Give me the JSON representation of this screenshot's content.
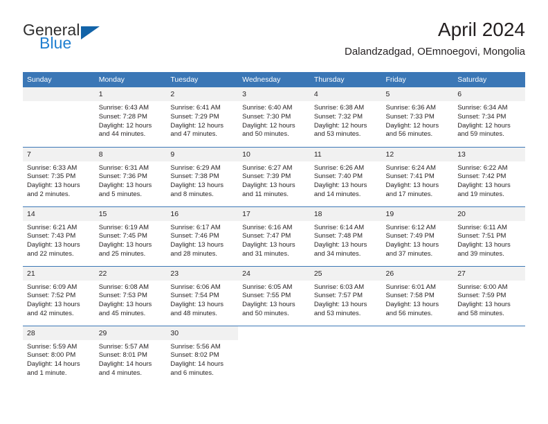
{
  "brand": {
    "name_part1": "General",
    "name_part2": "Blue",
    "accent_color": "#1263a8",
    "blue_text_color": "#1f7fd0"
  },
  "header": {
    "title": "April 2024",
    "subtitle": "Dalandzadgad, OEmnoegovi, Mongolia"
  },
  "calendar": {
    "header_color": "#3b77b6",
    "daynum_band_color": "#f1f1f1",
    "weekday_headers": [
      "Sunday",
      "Monday",
      "Tuesday",
      "Wednesday",
      "Thursday",
      "Friday",
      "Saturday"
    ],
    "weeks": [
      [
        {
          "day": "",
          "sunrise": "",
          "sunset": "",
          "daylight_line1": "",
          "daylight_line2": ""
        },
        {
          "day": "1",
          "sunrise": "Sunrise: 6:43 AM",
          "sunset": "Sunset: 7:28 PM",
          "daylight_line1": "Daylight: 12 hours",
          "daylight_line2": "and 44 minutes."
        },
        {
          "day": "2",
          "sunrise": "Sunrise: 6:41 AM",
          "sunset": "Sunset: 7:29 PM",
          "daylight_line1": "Daylight: 12 hours",
          "daylight_line2": "and 47 minutes."
        },
        {
          "day": "3",
          "sunrise": "Sunrise: 6:40 AM",
          "sunset": "Sunset: 7:30 PM",
          "daylight_line1": "Daylight: 12 hours",
          "daylight_line2": "and 50 minutes."
        },
        {
          "day": "4",
          "sunrise": "Sunrise: 6:38 AM",
          "sunset": "Sunset: 7:32 PM",
          "daylight_line1": "Daylight: 12 hours",
          "daylight_line2": "and 53 minutes."
        },
        {
          "day": "5",
          "sunrise": "Sunrise: 6:36 AM",
          "sunset": "Sunset: 7:33 PM",
          "daylight_line1": "Daylight: 12 hours",
          "daylight_line2": "and 56 minutes."
        },
        {
          "day": "6",
          "sunrise": "Sunrise: 6:34 AM",
          "sunset": "Sunset: 7:34 PM",
          "daylight_line1": "Daylight: 12 hours",
          "daylight_line2": "and 59 minutes."
        }
      ],
      [
        {
          "day": "7",
          "sunrise": "Sunrise: 6:33 AM",
          "sunset": "Sunset: 7:35 PM",
          "daylight_line1": "Daylight: 13 hours",
          "daylight_line2": "and 2 minutes."
        },
        {
          "day": "8",
          "sunrise": "Sunrise: 6:31 AM",
          "sunset": "Sunset: 7:36 PM",
          "daylight_line1": "Daylight: 13 hours",
          "daylight_line2": "and 5 minutes."
        },
        {
          "day": "9",
          "sunrise": "Sunrise: 6:29 AM",
          "sunset": "Sunset: 7:38 PM",
          "daylight_line1": "Daylight: 13 hours",
          "daylight_line2": "and 8 minutes."
        },
        {
          "day": "10",
          "sunrise": "Sunrise: 6:27 AM",
          "sunset": "Sunset: 7:39 PM",
          "daylight_line1": "Daylight: 13 hours",
          "daylight_line2": "and 11 minutes."
        },
        {
          "day": "11",
          "sunrise": "Sunrise: 6:26 AM",
          "sunset": "Sunset: 7:40 PM",
          "daylight_line1": "Daylight: 13 hours",
          "daylight_line2": "and 14 minutes."
        },
        {
          "day": "12",
          "sunrise": "Sunrise: 6:24 AM",
          "sunset": "Sunset: 7:41 PM",
          "daylight_line1": "Daylight: 13 hours",
          "daylight_line2": "and 17 minutes."
        },
        {
          "day": "13",
          "sunrise": "Sunrise: 6:22 AM",
          "sunset": "Sunset: 7:42 PM",
          "daylight_line1": "Daylight: 13 hours",
          "daylight_line2": "and 19 minutes."
        }
      ],
      [
        {
          "day": "14",
          "sunrise": "Sunrise: 6:21 AM",
          "sunset": "Sunset: 7:43 PM",
          "daylight_line1": "Daylight: 13 hours",
          "daylight_line2": "and 22 minutes."
        },
        {
          "day": "15",
          "sunrise": "Sunrise: 6:19 AM",
          "sunset": "Sunset: 7:45 PM",
          "daylight_line1": "Daylight: 13 hours",
          "daylight_line2": "and 25 minutes."
        },
        {
          "day": "16",
          "sunrise": "Sunrise: 6:17 AM",
          "sunset": "Sunset: 7:46 PM",
          "daylight_line1": "Daylight: 13 hours",
          "daylight_line2": "and 28 minutes."
        },
        {
          "day": "17",
          "sunrise": "Sunrise: 6:16 AM",
          "sunset": "Sunset: 7:47 PM",
          "daylight_line1": "Daylight: 13 hours",
          "daylight_line2": "and 31 minutes."
        },
        {
          "day": "18",
          "sunrise": "Sunrise: 6:14 AM",
          "sunset": "Sunset: 7:48 PM",
          "daylight_line1": "Daylight: 13 hours",
          "daylight_line2": "and 34 minutes."
        },
        {
          "day": "19",
          "sunrise": "Sunrise: 6:12 AM",
          "sunset": "Sunset: 7:49 PM",
          "daylight_line1": "Daylight: 13 hours",
          "daylight_line2": "and 37 minutes."
        },
        {
          "day": "20",
          "sunrise": "Sunrise: 6:11 AM",
          "sunset": "Sunset: 7:51 PM",
          "daylight_line1": "Daylight: 13 hours",
          "daylight_line2": "and 39 minutes."
        }
      ],
      [
        {
          "day": "21",
          "sunrise": "Sunrise: 6:09 AM",
          "sunset": "Sunset: 7:52 PM",
          "daylight_line1": "Daylight: 13 hours",
          "daylight_line2": "and 42 minutes."
        },
        {
          "day": "22",
          "sunrise": "Sunrise: 6:08 AM",
          "sunset": "Sunset: 7:53 PM",
          "daylight_line1": "Daylight: 13 hours",
          "daylight_line2": "and 45 minutes."
        },
        {
          "day": "23",
          "sunrise": "Sunrise: 6:06 AM",
          "sunset": "Sunset: 7:54 PM",
          "daylight_line1": "Daylight: 13 hours",
          "daylight_line2": "and 48 minutes."
        },
        {
          "day": "24",
          "sunrise": "Sunrise: 6:05 AM",
          "sunset": "Sunset: 7:55 PM",
          "daylight_line1": "Daylight: 13 hours",
          "daylight_line2": "and 50 minutes."
        },
        {
          "day": "25",
          "sunrise": "Sunrise: 6:03 AM",
          "sunset": "Sunset: 7:57 PM",
          "daylight_line1": "Daylight: 13 hours",
          "daylight_line2": "and 53 minutes."
        },
        {
          "day": "26",
          "sunrise": "Sunrise: 6:01 AM",
          "sunset": "Sunset: 7:58 PM",
          "daylight_line1": "Daylight: 13 hours",
          "daylight_line2": "and 56 minutes."
        },
        {
          "day": "27",
          "sunrise": "Sunrise: 6:00 AM",
          "sunset": "Sunset: 7:59 PM",
          "daylight_line1": "Daylight: 13 hours",
          "daylight_line2": "and 58 minutes."
        }
      ],
      [
        {
          "day": "28",
          "sunrise": "Sunrise: 5:59 AM",
          "sunset": "Sunset: 8:00 PM",
          "daylight_line1": "Daylight: 14 hours",
          "daylight_line2": "and 1 minute."
        },
        {
          "day": "29",
          "sunrise": "Sunrise: 5:57 AM",
          "sunset": "Sunset: 8:01 PM",
          "daylight_line1": "Daylight: 14 hours",
          "daylight_line2": "and 4 minutes."
        },
        {
          "day": "30",
          "sunrise": "Sunrise: 5:56 AM",
          "sunset": "Sunset: 8:02 PM",
          "daylight_line1": "Daylight: 14 hours",
          "daylight_line2": "and 6 minutes."
        },
        {
          "day": "",
          "sunrise": "",
          "sunset": "",
          "daylight_line1": "",
          "daylight_line2": ""
        },
        {
          "day": "",
          "sunrise": "",
          "sunset": "",
          "daylight_line1": "",
          "daylight_line2": ""
        },
        {
          "day": "",
          "sunrise": "",
          "sunset": "",
          "daylight_line1": "",
          "daylight_line2": ""
        },
        {
          "day": "",
          "sunrise": "",
          "sunset": "",
          "daylight_line1": "",
          "daylight_line2": ""
        }
      ]
    ]
  }
}
